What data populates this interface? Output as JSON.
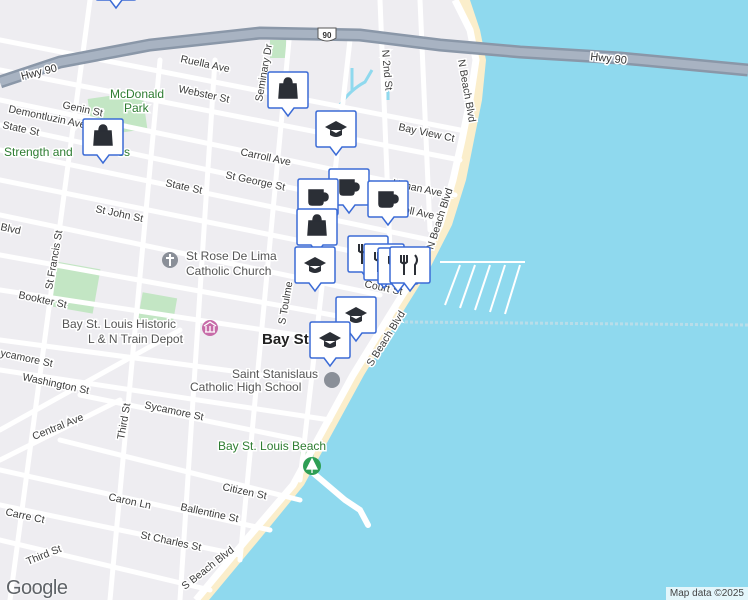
{
  "map": {
    "roads": {
      "hwy90": "Hwy 90",
      "hwy90_east": "Hwy 90",
      "route_shield": "90",
      "ruella": "Ruella Ave",
      "webster": "Webster St",
      "genin": "Genin St",
      "demontluzin": "Demontluzin Ave",
      "state_west": "State St",
      "carroll": "Carroll Ave",
      "st_george": "St George St",
      "state_main": "State St",
      "st_john": "St John St",
      "blvd_w": "Blvd",
      "ulman": "Ulman Ave",
      "carroll_east": "roll Ave",
      "bay_view": "Bay View Ct",
      "n2nd": "N 2nd St",
      "seminary": "Seminary Dr",
      "n_beach_upper": "N Beach Blvd",
      "n_beach_mid": "N Beach Blvd",
      "n_beach_lower": "N Beach Blvd",
      "st_francis": "St Francis St",
      "bookter": "Bookter St",
      "toulme": "S Toulme",
      "court": "Court St",
      "s_beach_upper": "S Beach Blvd",
      "s_beach_lower": "S Beach Blvd",
      "sycamore_w": "ycamore St",
      "washington": "Washington St",
      "central": "Central Ave",
      "third": "Third St",
      "sycamore": "Sycamore St",
      "citizen": "Citizen St",
      "caron": "Caron Ln",
      "ballentine": "Ballentine St",
      "carre": "Carre Ct",
      "st_charles": "St Charles St",
      "third_sw": "Third St"
    },
    "places": {
      "mcdonald_park_1": "McDonald",
      "mcdonald_park_2": "Park",
      "strength_1": "Strength and",
      "strength_2": "ss",
      "st_rose_1": "St Rose De Lima",
      "st_rose_2": "Catholic Church",
      "depot_1": "Bay St. Louis Historic",
      "depot_2": "L & N Train Depot",
      "town": "Bay St Lou",
      "stanislaus_1": "Saint Stanislaus",
      "stanislaus_2": "Catholic High School",
      "beach": "Bay St. Louis Beach"
    },
    "attribution": "Map data ©2025",
    "logo": "Google",
    "colors": {
      "water": "#8fd9ee",
      "land": "#eeedf1",
      "road": "#ffffff",
      "highway": "#8a97a8",
      "park": "#c3e6c4",
      "beach": "#fbeecb",
      "marker_border": "#3b6bd6",
      "icon": "#2b2f36"
    },
    "markers": [
      {
        "name": "shopping-marker",
        "icon": "shopping-bag-icon"
      },
      {
        "name": "shopping-marker",
        "icon": "shopping-bag-icon"
      },
      {
        "name": "shopping-marker",
        "icon": "shopping-bag-icon"
      },
      {
        "name": "school-marker",
        "icon": "graduation-cap-icon"
      },
      {
        "name": "cafe-marker",
        "icon": "coffee-cup-icon"
      },
      {
        "name": "cafe-marker",
        "icon": "coffee-cup-icon"
      },
      {
        "name": "cafe-marker",
        "icon": "coffee-cup-icon"
      },
      {
        "name": "shopping-marker",
        "icon": "shopping-bag-icon"
      },
      {
        "name": "restaurant-marker",
        "icon": "fork-knife-icon"
      },
      {
        "name": "restaurant-marker",
        "icon": "fork-knife-icon"
      },
      {
        "name": "restaurant-marker",
        "icon": "fork-knife-icon"
      },
      {
        "name": "restaurant-marker",
        "icon": "fork-knife-icon"
      },
      {
        "name": "school-marker",
        "icon": "graduation-cap-icon"
      },
      {
        "name": "school-marker",
        "icon": "graduation-cap-icon"
      },
      {
        "name": "school-marker",
        "icon": "graduation-cap-icon"
      }
    ]
  }
}
